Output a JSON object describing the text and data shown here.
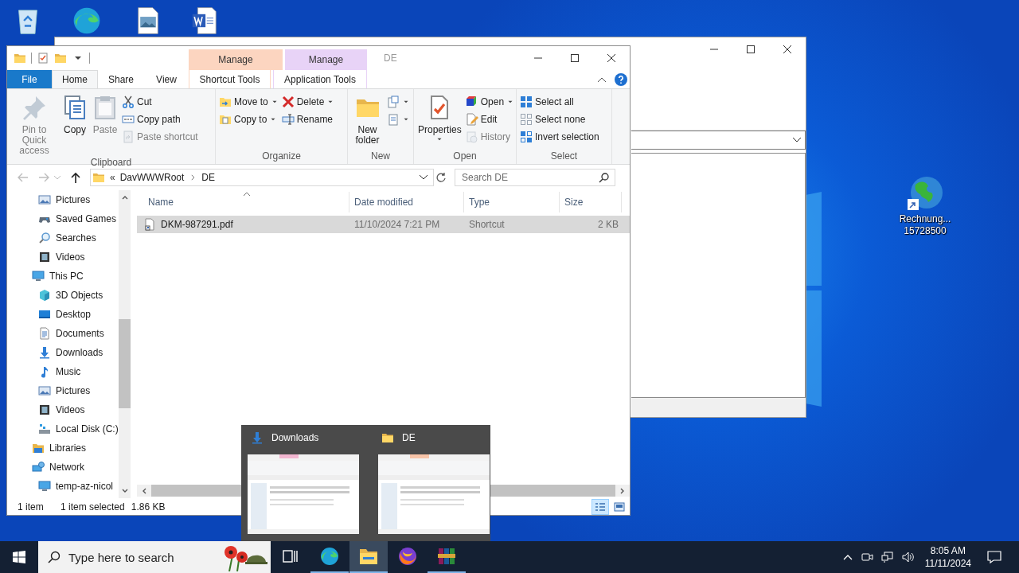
{
  "desktop_icons": [
    {
      "label_lines": [
        "Rechnung...",
        "15728500"
      ]
    }
  ],
  "explorer": {
    "title": "DE",
    "context_tabs": [
      {
        "group": "Manage",
        "label": "Shortcut Tools",
        "color": "#fcd5c0",
        "selected": false
      },
      {
        "group": "Manage",
        "label": "Application Tools",
        "color": "#e8d3f7",
        "selected": false
      }
    ],
    "tabs": [
      {
        "label": "File",
        "kind": "file",
        "selected": false
      },
      {
        "label": "Home",
        "kind": "plain",
        "selected": true
      },
      {
        "label": "Share",
        "kind": "plain",
        "selected": false
      },
      {
        "label": "View",
        "kind": "plain",
        "selected": false
      }
    ],
    "ribbon_groups": [
      {
        "name": "Clipboard",
        "columns": [
          [
            {
              "label": "Pin to Quick access",
              "kind": "large",
              "disabled": true,
              "dropdown": false
            }
          ],
          [
            {
              "label": "Copy",
              "kind": "large",
              "disabled": false,
              "dropdown": false
            }
          ],
          [
            {
              "label": "Paste",
              "kind": "large",
              "disabled": true,
              "dropdown": false
            }
          ],
          [
            {
              "label": "Cut",
              "kind": "small",
              "disabled": false,
              "dropdown": false
            },
            {
              "label": "Copy path",
              "kind": "small",
              "disabled": false,
              "dropdown": false
            },
            {
              "label": "Paste shortcut",
              "kind": "small",
              "disabled": true,
              "dropdown": false
            }
          ]
        ]
      },
      {
        "name": "Organize",
        "columns": [
          [
            {
              "label": "Move to",
              "kind": "small",
              "disabled": false,
              "dropdown": true
            },
            {
              "label": "Copy to",
              "kind": "small",
              "disabled": false,
              "dropdown": true
            }
          ],
          [
            {
              "label": "Delete",
              "kind": "small",
              "disabled": false,
              "dropdown": true
            },
            {
              "label": "Rename",
              "kind": "small",
              "disabled": false,
              "dropdown": false
            }
          ]
        ]
      },
      {
        "name": "New",
        "columns": [
          [
            {
              "label": "New folder",
              "kind": "large",
              "disabled": false,
              "dropdown": false
            }
          ],
          [
            {
              "kind": "icon",
              "disabled": false,
              "dropdown": true
            },
            {
              "kind": "icon",
              "disabled": false,
              "dropdown": true
            }
          ]
        ]
      },
      {
        "name": "Open",
        "columns": [
          [
            {
              "label": "Properties",
              "kind": "large",
              "disabled": false,
              "dropdown": true
            }
          ],
          [
            {
              "label": "Open",
              "kind": "small",
              "disabled": false,
              "dropdown": true
            },
            {
              "label": "Edit",
              "kind": "small",
              "disabled": false,
              "dropdown": false
            },
            {
              "label": "History",
              "kind": "small",
              "disabled": true,
              "dropdown": false
            }
          ]
        ]
      },
      {
        "name": "Select",
        "columns": [
          [
            {
              "label": "Select all",
              "kind": "small",
              "disabled": false,
              "dropdown": false
            },
            {
              "label": "Select none",
              "kind": "small",
              "disabled": false,
              "dropdown": false
            },
            {
              "label": "Invert selection",
              "kind": "small",
              "disabled": false,
              "dropdown": false
            }
          ]
        ]
      }
    ],
    "nav_buttons": [
      {
        "kind": "back",
        "disabled": true
      },
      {
        "kind": "forward",
        "disabled": true
      },
      {
        "kind": "recent",
        "disabled": true
      },
      {
        "kind": "up",
        "disabled": false
      }
    ],
    "address": {
      "overflow": "«",
      "path": [
        "DavWWWRoot",
        "DE"
      ]
    },
    "search": {
      "placeholder": "Search DE"
    },
    "nav_tree": [
      {
        "children": [
          {
            "label": "Pictures"
          },
          {
            "label": "Saved Games"
          },
          {
            "label": "Searches"
          },
          {
            "label": "Videos"
          }
        ]
      },
      {
        "label": "This PC",
        "children": [
          {
            "label": "3D Objects"
          },
          {
            "label": "Desktop"
          },
          {
            "label": "Documents"
          },
          {
            "label": "Downloads"
          },
          {
            "label": "Music"
          },
          {
            "label": "Pictures"
          },
          {
            "label": "Videos"
          },
          {
            "label": "Local Disk (C:)"
          }
        ]
      },
      {
        "label": "Libraries"
      },
      {
        "label": "Network",
        "children": [
          {
            "label": "temp-az-nicol"
          }
        ]
      }
    ],
    "columns": [
      {
        "label": "Name",
        "sorted": true
      },
      {
        "label": "Date modified",
        "sorted": false
      },
      {
        "label": "Type",
        "sorted": false
      },
      {
        "label": "Size",
        "sorted": false
      }
    ],
    "files": [
      {
        "name": "DKM-987291.pdf",
        "date": "11/10/2024 7:21 PM",
        "type": "Shortcut",
        "size": "2 KB",
        "selected": true
      }
    ],
    "status": {
      "count": "1 item",
      "selection": "1 item selected",
      "size": "1.86 KB"
    },
    "views": [
      {
        "selected": true
      },
      {
        "selected": false
      }
    ]
  },
  "thumbnail_popup": {
    "windows": [
      {
        "title": "Downloads"
      },
      {
        "title": "DE"
      }
    ]
  },
  "taskbar": {
    "search_placeholder": "Type here to search",
    "apps": [
      {
        "active": false,
        "running": false
      },
      {
        "active": false,
        "running": true
      },
      {
        "active": true,
        "running": true
      },
      {
        "active": false,
        "running": false
      },
      {
        "active": false,
        "running": true
      }
    ],
    "time": "8:05 AM",
    "date": "11/11/2024"
  }
}
